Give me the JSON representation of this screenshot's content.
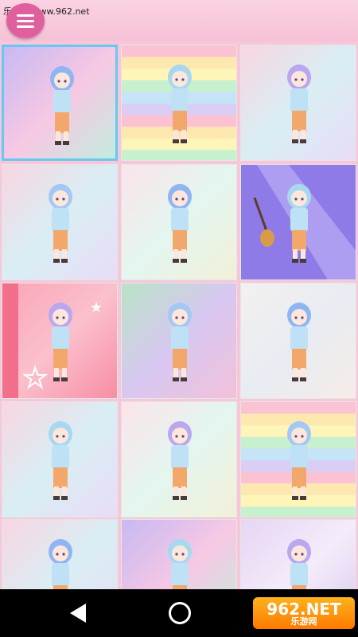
{
  "watermark": {
    "site": "乐游网 www.962.net"
  },
  "menu": {
    "icon": "hamburger-menu-icon"
  },
  "brand": {
    "logo_text": "962.NET",
    "logo_sub": "乐游网"
  },
  "navigation": {
    "back_icon": "back-triangle-icon",
    "home_icon": "home-circle-icon"
  },
  "colors": {
    "topbar": "#f7c6d9",
    "menu_button": "#e0609e",
    "selection_border": "#67c8f2",
    "navbar": "#000000"
  },
  "gallery": {
    "tiles": [
      {
        "theme": "pastel-gradient",
        "selected": true
      },
      {
        "theme": "rainbow-stripes",
        "selected": false
      },
      {
        "theme": "pastel-watercolor",
        "selected": false
      },
      {
        "theme": "pastel-watercolor",
        "selected": false
      },
      {
        "theme": "soft-pastel",
        "selected": false
      },
      {
        "theme": "purple-diagonal-guitar",
        "selected": false
      },
      {
        "theme": "pink-stars",
        "selected": false
      },
      {
        "theme": "pastel-blur",
        "selected": false
      },
      {
        "theme": "pale-pastel",
        "selected": false
      },
      {
        "theme": "pastel-watercolor",
        "selected": false
      },
      {
        "theme": "soft-pastel",
        "selected": false
      },
      {
        "theme": "rainbow-stripes",
        "selected": false
      },
      {
        "theme": "pastel-watercolor",
        "selected": false
      },
      {
        "theme": "pastel-gradient",
        "selected": false
      },
      {
        "theme": "lavender-stripes",
        "selected": false
      }
    ]
  }
}
